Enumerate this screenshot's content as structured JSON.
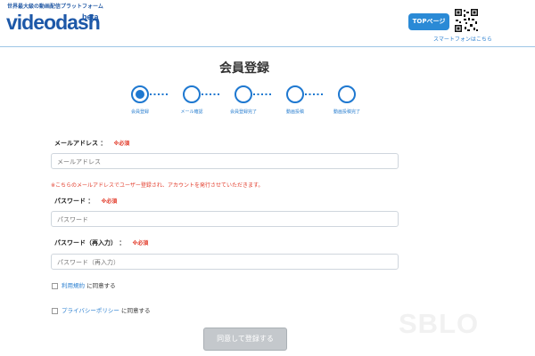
{
  "header": {
    "tagline": "世界最大級の動画配信プラットフォーム",
    "logo": "videodash",
    "logo_beta": "beta",
    "top_button": "TOPページ",
    "smartphone_link": "スマートフォンはこちら"
  },
  "page_title": "会員登録",
  "steps": {
    "labels": [
      "会員登録",
      "メール確認",
      "会員登録完了",
      "動画投稿",
      "動画投稿完了"
    ],
    "current": 1
  },
  "form": {
    "email_label": "メールアドレス ：",
    "email_required": "※必須",
    "email_placeholder": "メールアドレス",
    "email_note": "※こちらのメールアドレスでユーザー登録され、アカウントを発行させていただきます。",
    "password_label": "パスワード ：",
    "password_required": "※必須",
    "password_placeholder": "パスワード",
    "password_confirm_label": "パスワード（再入力） ：",
    "password_confirm_required": "※必須",
    "password_confirm_placeholder": "パスワード（再入力）",
    "terms_link": "利用規約",
    "terms_suffix": "に同意する",
    "privacy_link": "プライバシーポリシー",
    "privacy_suffix": "に同意する",
    "submit": "同意して登録する"
  },
  "watermark": "SBLO",
  "colors": {
    "accent": "#2a8ad6",
    "required": "#e23b2a",
    "step": "#1e78d0"
  }
}
